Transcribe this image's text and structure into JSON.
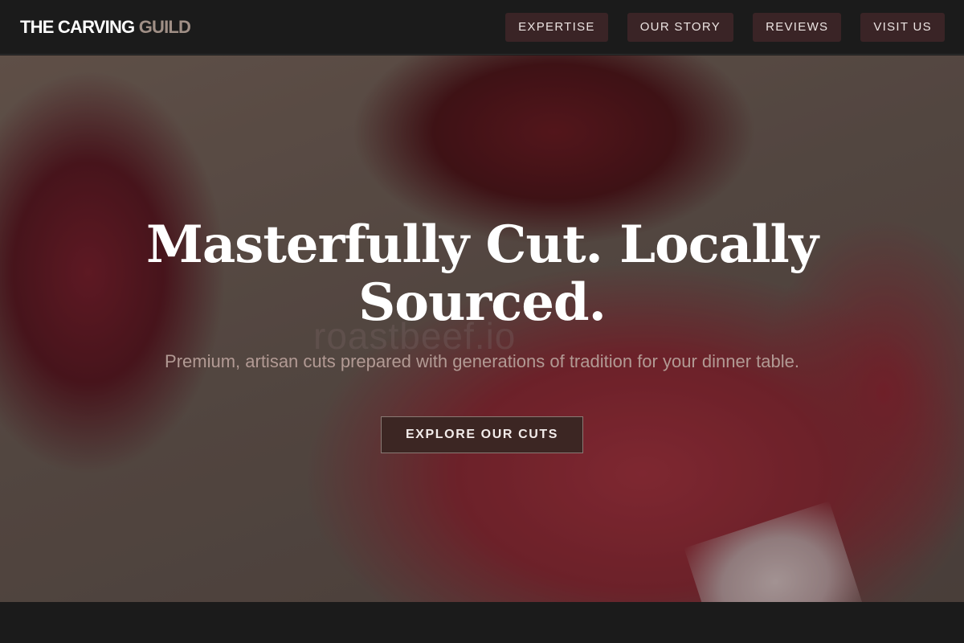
{
  "brand": {
    "name_main": "THE CARVING ",
    "name_accent": "GUILD"
  },
  "nav": {
    "items": [
      {
        "label": "EXPERTISE"
      },
      {
        "label": "OUR STORY"
      },
      {
        "label": "REVIEWS"
      },
      {
        "label": "VISIT US"
      }
    ]
  },
  "hero": {
    "title": "Masterfully Cut. Locally Sourced.",
    "watermark": "roastbeef.io",
    "subtitle": "Premium, artisan cuts prepared with generations of tradition for your dinner table.",
    "cta_label": "EXPLORE OUR CUTS"
  },
  "colors": {
    "background": "#1b1b1b",
    "nav_button": "#3a2426",
    "logo_accent": "#a08f86",
    "cta_background": "#3c2623"
  }
}
